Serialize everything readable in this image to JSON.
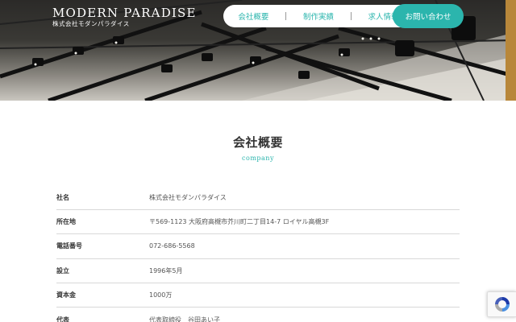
{
  "header": {
    "logo_main": "MODERN PARADISE",
    "logo_sub": "株式会社モダンパラダイス",
    "nav": [
      {
        "label": "会社概要"
      },
      {
        "label": "制作実績"
      },
      {
        "label": "求人情報"
      }
    ],
    "contact_label": "お問い合わせ"
  },
  "section": {
    "title": "会社概要",
    "subtitle": "company"
  },
  "company_info": [
    {
      "label": "社名",
      "value": "株式会社モダンパラダイス"
    },
    {
      "label": "所在地",
      "value": "〒569-1123 大阪府高槻市芥川町二丁目14-7 ロイヤル高槻3F"
    },
    {
      "label": "電話番号",
      "value": "072-686-5568"
    },
    {
      "label": "設立",
      "value": "1996年5月"
    },
    {
      "label": "資本金",
      "value": "1000万"
    },
    {
      "label": "代表",
      "value": "代表取締役　谷田あい子"
    }
  ],
  "colors": {
    "accent": "#2bb5ad",
    "text": "#333333"
  },
  "icons": {
    "recaptcha": "recaptcha-icon"
  }
}
